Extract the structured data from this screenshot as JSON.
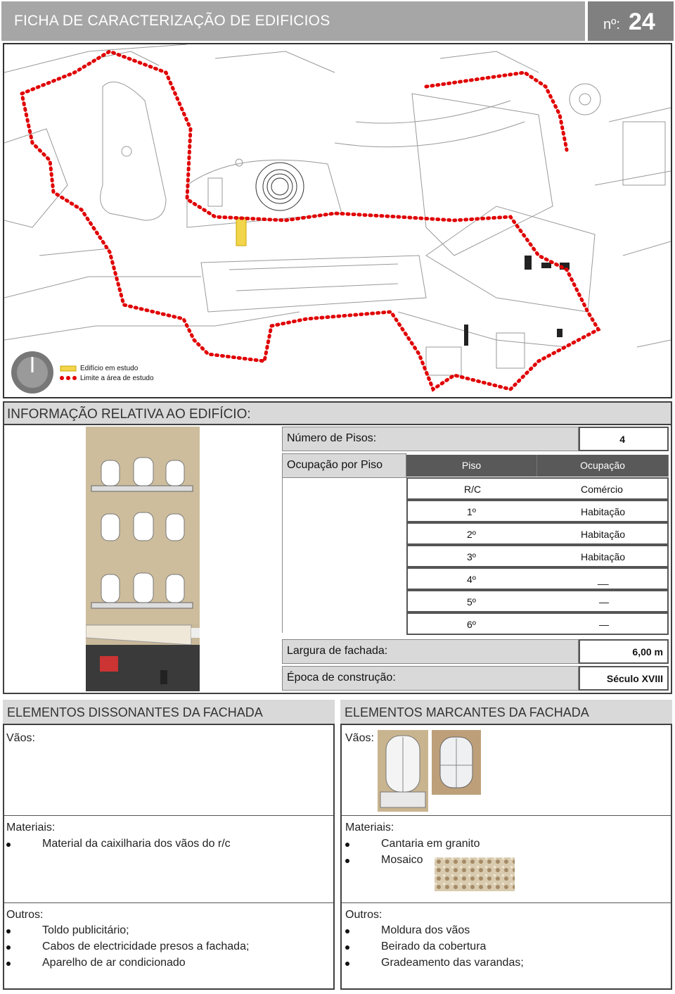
{
  "header": {
    "title": "FICHA DE CARACTERIZAÇÃO DE EDIFICIOS",
    "number_label": "nº:",
    "number": "24"
  },
  "map_legend": {
    "study_building": "Edifício em estudo",
    "study_area_limit": "Limite a área de estudo",
    "colors": {
      "building": "#f2d54a",
      "limit": "#e00000"
    }
  },
  "info": {
    "title": "INFORMAÇÃO RELATIVA AO EDIFÍCIO:",
    "floors_label": "Número de Pisos:",
    "floors_value": "4",
    "occupancy_label": "Ocupação por Piso",
    "table_headers": [
      "Piso",
      "Ocupação"
    ],
    "rows": [
      {
        "piso": "R/C",
        "ocupacao": "Comércio"
      },
      {
        "piso": "1º",
        "ocupacao": "Habitação"
      },
      {
        "piso": "2º",
        "ocupacao": "Habitação"
      },
      {
        "piso": "3º",
        "ocupacao": "Habitação"
      },
      {
        "piso": "4º",
        "ocupacao": "__"
      },
      {
        "piso": "5º",
        "ocupacao": "—"
      },
      {
        "piso": "6º",
        "ocupacao": "—"
      }
    ],
    "width_label": "Largura de fachada:",
    "width_value": "6,00 m",
    "era_label": "Época de construção:",
    "era_value": "Século XVIII"
  },
  "dissonant": {
    "title": "ELEMENTOS DISSONANTES DA FACHADA",
    "vaos_label": "Vãos:",
    "materiais_label": "Materiais:",
    "materiais": [
      "Material da caixilharia dos vãos do r/c"
    ],
    "outros_label": "Outros:",
    "outros": [
      "Toldo publicitário;",
      "Cabos de electricidade presos a fachada;",
      "Aparelho de ar condicionado"
    ]
  },
  "marking": {
    "title": "ELEMENTOS MARCANTES DA FACHADA",
    "vaos_label": "Vãos:",
    "materiais_label": "Materiais:",
    "materiais": [
      "Cantaria em granito",
      "Mosaico"
    ],
    "outros_label": "Outros:",
    "outros": [
      "Moldura dos vãos",
      "Beirado da cobertura",
      "Gradeamento das varandas;"
    ]
  }
}
